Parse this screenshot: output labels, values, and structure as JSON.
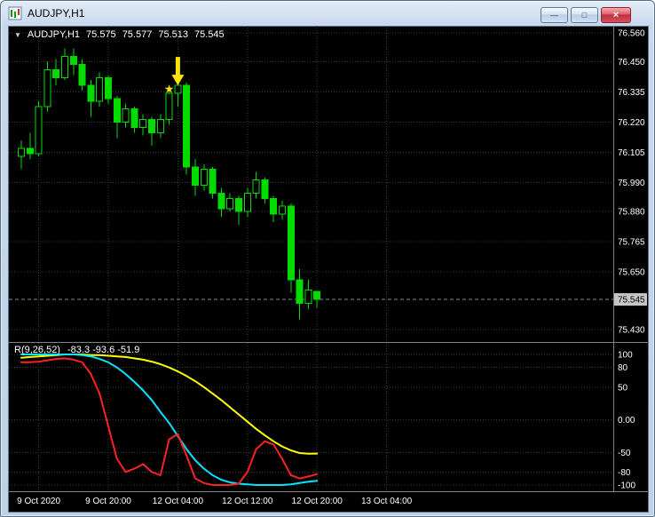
{
  "window": {
    "title": "AUDJPY,H1",
    "minimize_glyph": "—",
    "maximize_glyph": "□",
    "close_glyph": "×"
  },
  "info": {
    "dropdown_glyph": "▼",
    "symbol_period": "AUDJPY,H1",
    "open": "75.575",
    "high": "75.577",
    "low": "75.513",
    "close": "75.545"
  },
  "indicator_pane": {
    "name": "R(9,26,52)",
    "values_text": "-83.3 -93.6 -51.9"
  },
  "chart_data": {
    "type": "candlestick",
    "symbol": "AUDJPY",
    "timeframe": "H1",
    "price_axis": {
      "gridlines": [
        {
          "label": "76.560",
          "price": 76.56
        },
        {
          "label": "76.450",
          "price": 76.45
        },
        {
          "label": "76.335",
          "price": 76.335
        },
        {
          "label": "76.220",
          "price": 76.22
        },
        {
          "label": "76.105",
          "price": 76.105
        },
        {
          "label": "75.990",
          "price": 75.99
        },
        {
          "label": "75.880",
          "price": 75.88
        },
        {
          "label": "75.765",
          "price": 75.765
        },
        {
          "label": "75.650",
          "price": 75.65
        },
        {
          "label": "75.430",
          "price": 75.43
        }
      ],
      "bid": {
        "label": "75.545",
        "price": 75.545
      }
    },
    "value_axis": [
      {
        "label": "100",
        "value": 100
      },
      {
        "label": "80",
        "value": 80
      },
      {
        "label": "50",
        "value": 50
      },
      {
        "label": "0.00",
        "value": 0
      },
      {
        "label": "-50",
        "value": -50
      },
      {
        "label": "-80",
        "value": -80
      },
      {
        "label": "-100",
        "value": -100
      }
    ],
    "time_axis": [
      {
        "label": "9 Oct 2020",
        "bar": 2
      },
      {
        "label": "9 Oct 20:00",
        "bar": 10
      },
      {
        "label": "12 Oct 04:00",
        "bar": 18
      },
      {
        "label": "12 Oct 12:00",
        "bar": 26
      },
      {
        "label": "12 Oct 20:00",
        "bar": 34
      },
      {
        "label": "13 Oct 04:00",
        "bar": 42
      }
    ],
    "candles": {
      "open": [
        76.09,
        76.12,
        76.1,
        76.28,
        76.42,
        76.39,
        76.47,
        76.44,
        76.36,
        76.3,
        76.39,
        76.31,
        76.22,
        76.27,
        76.2,
        76.23,
        76.18,
        76.23,
        76.33,
        76.36,
        76.05,
        75.98,
        76.04,
        75.95,
        75.89,
        75.93,
        75.88,
        75.95,
        76.0,
        75.93,
        75.87,
        75.9,
        75.62,
        75.53,
        75.575
      ],
      "high": [
        76.15,
        76.18,
        76.3,
        76.45,
        76.46,
        76.5,
        76.5,
        76.46,
        76.38,
        76.41,
        76.4,
        76.32,
        76.29,
        76.28,
        76.25,
        76.24,
        76.25,
        76.35,
        76.39,
        76.37,
        76.08,
        76.06,
        76.05,
        75.97,
        75.95,
        75.94,
        75.97,
        76.03,
        76.01,
        75.94,
        75.92,
        75.91,
        75.66,
        75.62,
        75.577
      ],
      "low": [
        76.04,
        76.08,
        76.09,
        76.26,
        76.36,
        76.38,
        76.4,
        76.34,
        76.24,
        76.28,
        76.29,
        76.16,
        76.2,
        76.18,
        76.17,
        76.13,
        76.16,
        76.21,
        76.28,
        76.02,
        75.94,
        75.96,
        75.93,
        75.86,
        75.88,
        75.83,
        75.86,
        75.93,
        75.91,
        75.84,
        75.85,
        75.57,
        75.47,
        75.51,
        75.513
      ],
      "close": [
        76.12,
        76.1,
        76.28,
        76.42,
        76.39,
        76.47,
        76.44,
        76.36,
        76.3,
        76.39,
        76.31,
        76.22,
        76.27,
        76.2,
        76.23,
        76.18,
        76.23,
        76.33,
        76.36,
        76.05,
        75.98,
        76.04,
        75.95,
        75.89,
        75.93,
        75.88,
        75.95,
        76.0,
        75.93,
        75.87,
        75.9,
        75.62,
        75.53,
        75.58,
        75.545
      ],
      "last_ohlc": {
        "open": 75.575,
        "high": 75.577,
        "low": 75.513,
        "close": 75.545
      }
    },
    "series": [
      {
        "name": "R9-red",
        "color": "#ff2222",
        "width": 2,
        "current": -83.3,
        "values": [
          88,
          88,
          89,
          91,
          93,
          94,
          92,
          88,
          70,
          40,
          -10,
          -60,
          -80,
          -75,
          -68,
          -80,
          -85,
          -30,
          -22,
          -55,
          -90,
          -97,
          -100,
          -100,
          -100,
          -98,
          -80,
          -45,
          -33,
          -38,
          -60,
          -85,
          -90,
          -87,
          -83.3
        ]
      },
      {
        "name": "R26-cyan",
        "color": "#00e5ff",
        "width": 2,
        "current": -93.6,
        "values": [
          100,
          100,
          100,
          100,
          100,
          100,
          100,
          99,
          97,
          93,
          88,
          80,
          70,
          58,
          45,
          30,
          12,
          -5,
          -25,
          -45,
          -62,
          -75,
          -85,
          -92,
          -96,
          -98,
          -99,
          -100,
          -100,
          -100,
          -100,
          -99,
          -97,
          -95,
          -93.6
        ]
      },
      {
        "name": "R52-yellow",
        "color": "#ffff00",
        "width": 2,
        "current": -51.9,
        "values": [
          95,
          96,
          97,
          98,
          99,
          100,
          100,
          100,
          99,
          99,
          98,
          97,
          96,
          94,
          92,
          89,
          85,
          80,
          74,
          67,
          59,
          50,
          40,
          30,
          19,
          8,
          -3,
          -14,
          -24,
          -33,
          -41,
          -47,
          -51,
          -52,
          -51.9
        ]
      }
    ],
    "markers": [
      {
        "type": "down-arrow",
        "bar": 18,
        "price": 76.36,
        "color": "#ffe400"
      },
      {
        "type": "star",
        "glyph": "★",
        "bar": 17,
        "price": 76.345,
        "color": "#ffe400"
      }
    ],
    "colors": {
      "background": "#000000",
      "grid": "#3a3a3a",
      "candle": "#00dc00",
      "separator": "#808080",
      "bid_line": "#7f8da0",
      "bid_box": "#c6c6c6",
      "axis_text": "#ffffff"
    }
  }
}
